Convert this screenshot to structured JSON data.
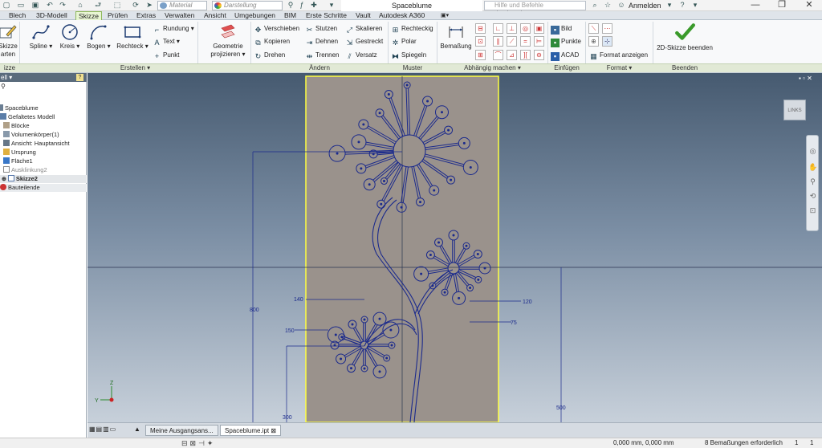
{
  "app": {
    "title": "Spaceblume",
    "help_search_placeholder": "Hilfe und Befehle durchsuchen...",
    "signin_label": "Anmelden",
    "material_placeholder": "Material",
    "appearance_placeholder": "Darstellung"
  },
  "tabs": [
    {
      "label": "Blech"
    },
    {
      "label": "3D-Modell"
    },
    {
      "label": "Skizze"
    },
    {
      "label": "Prüfen"
    },
    {
      "label": "Extras"
    },
    {
      "label": "Verwalten"
    },
    {
      "label": "Ansicht"
    },
    {
      "label": "Umgebungen"
    },
    {
      "label": "BIM"
    },
    {
      "label": "Erste Schritte"
    },
    {
      "label": "Vault"
    },
    {
      "label": "Autodesk A360"
    }
  ],
  "ribbon": {
    "sketch_start": {
      "line1": "Skizze",
      "line2": "arten"
    },
    "create": {
      "spline": "Spline",
      "circle": "Kreis",
      "arc": "Bogen",
      "rectangle": "Rechteck",
      "fillet": "Rundung",
      "text": "Text",
      "point": "Punkt"
    },
    "project": {
      "line1": "Geometrie",
      "line2": "projizieren"
    },
    "modify": {
      "move": "Verschieben",
      "copy": "Kopieren",
      "rotate": "Drehen",
      "trim": "Stutzen",
      "extend": "Dehnen",
      "split": "Trennen",
      "scale": "Skalieren",
      "stretch": "Gestreckt",
      "offset": "Versatz"
    },
    "pattern": {
      "rectangular": "Rechteckig",
      "circular": "Polar",
      "mirror": "Spiegeln"
    },
    "dimension": "Bemaßung",
    "insert": {
      "image": "Bild",
      "points": "Punkte",
      "acad": "ACAD"
    },
    "format": {
      "show_format": "Format anzeigen"
    },
    "finish": "2D-Skizze beenden",
    "panel_labels": {
      "sketch": "izze",
      "create": "Erstellen",
      "modify": "Ändern",
      "pattern": "Muster",
      "constrain": "Abhängig machen",
      "insert": "Einfügen",
      "format": "Format",
      "exit": "Beenden"
    }
  },
  "browser": {
    "header": "ell",
    "items": [
      {
        "label": "Spaceblume",
        "color": "#6b7f94"
      },
      {
        "label": "Gefaltetes Modell",
        "color": "#5a7da8"
      },
      {
        "label": "Blöcke",
        "color": "#b0a088"
      },
      {
        "label": "Volumenkörper(1)",
        "color": "#8899aa"
      },
      {
        "label": "Ansicht: Hauptansicht",
        "color": "#667788"
      },
      {
        "label": "Ursprung",
        "color": "#e0b040"
      },
      {
        "label": "Fläche1",
        "color": "#3a78c8"
      },
      {
        "label": "Ausklinkung2",
        "color": "#888888"
      },
      {
        "label": "Skizze2",
        "color": "#5577aa"
      },
      {
        "label": "Bauteilende",
        "color": "#cc3333"
      }
    ]
  },
  "viewcube_label": "LINKS",
  "dimensions": {
    "d800": "800",
    "d140": "140",
    "d150": "150",
    "d120": "120",
    "d75": "75",
    "d500": "500",
    "d300": "300"
  },
  "axis": {
    "z": "Z",
    "y": "Y"
  },
  "doc_tabs": [
    {
      "label": "Meine Ausgangsans..."
    },
    {
      "label": "Spaceblume.ipt"
    }
  ],
  "status": {
    "coords": "0,000 mm, 0,000 mm",
    "dims_needed": "8 Bemaßungen erforderlich",
    "num1": "1",
    "num2": "1"
  },
  "colors": {
    "sketch_line": "#1b2a8c",
    "panel": "#9a928c",
    "panel_border": "#ffff40",
    "active_tab": "#e8f5d4",
    "finish_green": "#3a9a2a"
  }
}
